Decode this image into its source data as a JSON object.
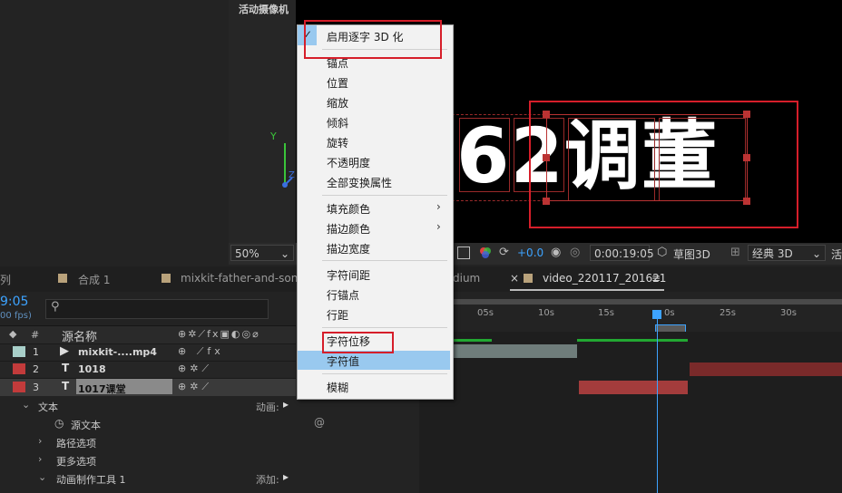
{
  "camera_panel": {
    "title": "活动摄像机",
    "axis_y": "Y",
    "axis_z": "Z"
  },
  "viewer": {
    "display_text": "62调董",
    "toolbar": {
      "zoom": "50%",
      "offset": "+0.0",
      "timecode": "0:00:19:05",
      "draft3d": "草图3D",
      "renderer": "经典 3D",
      "overflow": "活"
    }
  },
  "context_menu": {
    "items": [
      {
        "label": "启用逐字 3D 化",
        "checked": true
      },
      {
        "label": "锚点"
      },
      {
        "label": "位置"
      },
      {
        "label": "缩放"
      },
      {
        "label": "倾斜"
      },
      {
        "label": "旋转"
      },
      {
        "label": "不透明度"
      },
      {
        "label": "全部变换属性"
      },
      {
        "label": "填充颜色",
        "submenu": true
      },
      {
        "label": "描边颜色",
        "submenu": true
      },
      {
        "label": "描边宽度"
      },
      {
        "label": "字符间距"
      },
      {
        "label": "行锚点"
      },
      {
        "label": "行距"
      },
      {
        "label": "字符位移"
      },
      {
        "label": "字符值",
        "highlighted": true
      },
      {
        "label": "模糊"
      }
    ],
    "check_mark": "✓",
    "submenu_arrow": "›"
  },
  "timeline": {
    "tabs": [
      "列",
      "合成 1",
      "mixkit-father-and-son-thr",
      "dium",
      "video_220117_201621"
    ],
    "tab_close": "×",
    "tab_menu": "≡",
    "time": "9:05",
    "fps": "00 fps)",
    "col_num": "#",
    "col_source": "源名称",
    "ruler_ticks": [
      "0:00s",
      "05s",
      "10s",
      "15s",
      "20s",
      "25s",
      "30s"
    ],
    "playhead_label": "0s",
    "layers": [
      {
        "num": "1",
        "name": "mixkit-....mp4",
        "color": "#a8cfc9"
      },
      {
        "num": "2",
        "name": "1018",
        "color": "#c23b3b"
      },
      {
        "num": "3",
        "name": "1017课堂",
        "color": "#c23b3b"
      }
    ],
    "props": [
      {
        "label": "文本",
        "right": "动画:"
      },
      {
        "label": "源文本"
      },
      {
        "label": "路径选项"
      },
      {
        "label": "更多选项"
      },
      {
        "label": "动画制作工具 1",
        "right": "添加:"
      }
    ]
  },
  "colors": {
    "accent": "#3da3ff",
    "highlight": "#99c9ef",
    "annotation": "#d61e2a"
  }
}
